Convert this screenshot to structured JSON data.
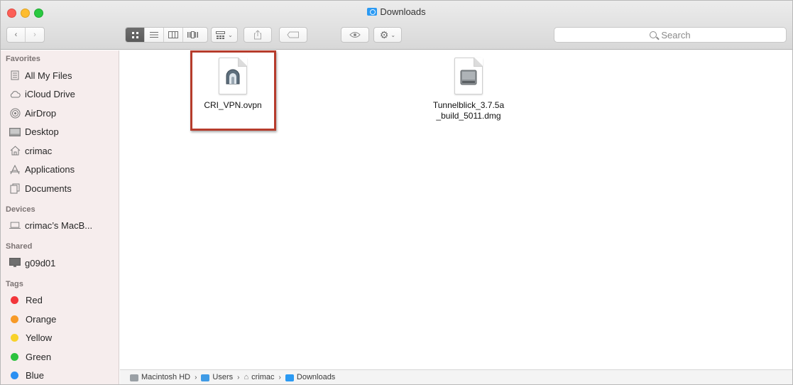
{
  "window": {
    "title": "Downloads"
  },
  "toolbar": {
    "back_icon": "chevron-left",
    "forward_icon": "chevron-right",
    "view_modes": [
      "icon-view",
      "list-view",
      "column-view",
      "cover-flow-view"
    ],
    "arrange_icon": "arrange-grid",
    "share_icon": "share",
    "tag_icon": "tag",
    "quicklook_icon": "eye",
    "action_icon": "gear",
    "search_placeholder": "Search"
  },
  "sidebar": {
    "favorites_heading": "Favorites",
    "favorites": [
      {
        "label": "All My Files",
        "icon": "all-files"
      },
      {
        "label": "iCloud Drive",
        "icon": "cloud"
      },
      {
        "label": "AirDrop",
        "icon": "airdrop"
      },
      {
        "label": "Desktop",
        "icon": "desktop"
      },
      {
        "label": "crimac",
        "icon": "home"
      },
      {
        "label": "Applications",
        "icon": "applications"
      },
      {
        "label": "Documents",
        "icon": "documents"
      }
    ],
    "devices_heading": "Devices",
    "devices": [
      {
        "label": "crimac’s MacB...",
        "icon": "laptop"
      }
    ],
    "shared_heading": "Shared",
    "shared": [
      {
        "label": "g09d01",
        "icon": "monitor"
      }
    ],
    "tags_heading": "Tags",
    "tags": [
      {
        "label": "Red",
        "color": "#f2353a"
      },
      {
        "label": "Orange",
        "color": "#f79a27"
      },
      {
        "label": "Yellow",
        "color": "#f8d22a"
      },
      {
        "label": "Green",
        "color": "#2cc23e"
      },
      {
        "label": "Blue",
        "color": "#2b8ff2"
      }
    ]
  },
  "files": [
    {
      "name": "CRI_VPN.ovpn",
      "icon": "tunnelblick-config",
      "highlighted": true
    },
    {
      "name_line1": "Tunnelblick_3.7.5a",
      "name_line2": "_build_5011.dmg",
      "icon": "disk-image"
    }
  ],
  "pathbar": {
    "items": [
      {
        "label": "Macintosh HD",
        "icon": "hard-drive"
      },
      {
        "label": "Users",
        "icon": "folder"
      },
      {
        "label": "crimac",
        "icon": "home"
      },
      {
        "label": "Downloads",
        "icon": "downloads-folder"
      }
    ],
    "separator": "›"
  }
}
